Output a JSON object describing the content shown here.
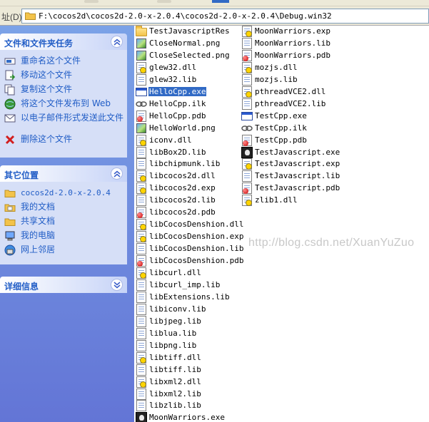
{
  "address": {
    "label": "址(D)",
    "path": "F:\\cocos2d\\cocos2d-2.0-x-2.0.4\\cocos2d-2.0-x-2.0.4\\Debug.win32"
  },
  "tasks_panel": {
    "title": "文件和文件夹任务",
    "items": [
      {
        "label": "重命名这个文件",
        "icon": "rename-icon"
      },
      {
        "label": "移动这个文件",
        "icon": "move-icon"
      },
      {
        "label": "复制这个文件",
        "icon": "copy-icon"
      },
      {
        "label": "将这个文件发布到 Web",
        "icon": "globe-publish-icon"
      },
      {
        "label": "以电子邮件形式发送此文件",
        "icon": "email-icon"
      },
      {
        "label": "删除这个文件",
        "icon": "delete-icon"
      }
    ]
  },
  "places_panel": {
    "title": "其它位置",
    "items": [
      {
        "label": "cocos2d-2.0-x-2.0.4",
        "icon": "folder-icon"
      },
      {
        "label": "我的文档",
        "icon": "folder-icon"
      },
      {
        "label": "共享文档",
        "icon": "folder-icon"
      },
      {
        "label": "我的电脑",
        "icon": "computer-icon"
      },
      {
        "label": "网上邻居",
        "icon": "network-icon"
      }
    ]
  },
  "details_panel": {
    "title": "详细信息"
  },
  "watermark": "http://blog.csdn.net/XuanYuZuo",
  "colors": {
    "pane_top": "#7ba2e7",
    "pane_bottom": "#6375d6",
    "link": "#215dc6",
    "selection": "#316ac5"
  },
  "files": {
    "column1": [
      {
        "name": "TestJavascriptRes",
        "type": "folder"
      },
      {
        "name": "CloseNormal.png",
        "type": "png"
      },
      {
        "name": "CloseSelected.png",
        "type": "png"
      },
      {
        "name": "glew32.dll",
        "type": "dll"
      },
      {
        "name": "glew32.lib",
        "type": "lib"
      },
      {
        "name": "HelloCpp.exe",
        "type": "exe",
        "selected": true
      },
      {
        "name": "HelloCpp.ilk",
        "type": "ilk"
      },
      {
        "name": "HelloCpp.pdb",
        "type": "pdb"
      },
      {
        "name": "HelloWorld.png",
        "type": "png"
      },
      {
        "name": "iconv.dll",
        "type": "dll"
      },
      {
        "name": "libBox2D.lib",
        "type": "lib"
      },
      {
        "name": "libchipmunk.lib",
        "type": "lib"
      },
      {
        "name": "libcocos2d.dll",
        "type": "dll"
      },
      {
        "name": "libcocos2d.exp",
        "type": "exp"
      },
      {
        "name": "libcocos2d.lib",
        "type": "lib"
      },
      {
        "name": "libcocos2d.pdb",
        "type": "pdb"
      },
      {
        "name": "libCocosDenshion.dll",
        "type": "dll"
      },
      {
        "name": "libCocosDenshion.exp",
        "type": "exp"
      },
      {
        "name": "libCocosDenshion.lib",
        "type": "lib"
      },
      {
        "name": "libCocosDenshion.pdb",
        "type": "pdb"
      },
      {
        "name": "libcurl.dll",
        "type": "dll"
      },
      {
        "name": "libcurl_imp.lib",
        "type": "lib"
      },
      {
        "name": "libExtensions.lib",
        "type": "lib"
      },
      {
        "name": "libiconv.lib",
        "type": "lib"
      },
      {
        "name": "libjpeg.lib",
        "type": "lib"
      },
      {
        "name": "liblua.lib",
        "type": "lib"
      },
      {
        "name": "libpng.lib",
        "type": "lib"
      },
      {
        "name": "libtiff.dll",
        "type": "dll"
      },
      {
        "name": "libtiff.lib",
        "type": "lib"
      },
      {
        "name": "libxml2.dll",
        "type": "dll"
      },
      {
        "name": "libxml2.lib",
        "type": "lib"
      },
      {
        "name": "libzlib.lib",
        "type": "lib"
      },
      {
        "name": "MoonWarriors.exe",
        "type": "exe-app"
      }
    ],
    "column2": [
      {
        "name": "MoonWarriors.exp",
        "type": "exp"
      },
      {
        "name": "MoonWarriors.lib",
        "type": "lib"
      },
      {
        "name": "MoonWarriors.pdb",
        "type": "pdb"
      },
      {
        "name": "mozjs.dll",
        "type": "dll"
      },
      {
        "name": "mozjs.lib",
        "type": "lib"
      },
      {
        "name": "pthreadVCE2.dll",
        "type": "dll"
      },
      {
        "name": "pthreadVCE2.lib",
        "type": "lib"
      },
      {
        "name": "TestCpp.exe",
        "type": "exe"
      },
      {
        "name": "TestCpp.ilk",
        "type": "ilk"
      },
      {
        "name": "TestCpp.pdb",
        "type": "pdb"
      },
      {
        "name": "TestJavascript.exe",
        "type": "exe-app"
      },
      {
        "name": "TestJavascript.exp",
        "type": "exp"
      },
      {
        "name": "TestJavascript.lib",
        "type": "lib"
      },
      {
        "name": "TestJavascript.pdb",
        "type": "pdb"
      },
      {
        "name": "zlib1.dll",
        "type": "dll"
      }
    ]
  }
}
